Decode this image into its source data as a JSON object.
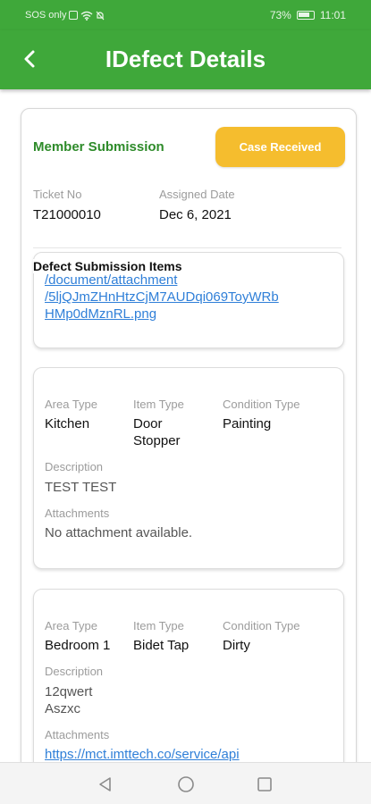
{
  "status_bar": {
    "left_text": "SOS only",
    "battery": "73%",
    "time": "11:01"
  },
  "app_bar": {
    "title": "IDefect Details"
  },
  "summary": {
    "heading": "Member Submission",
    "status_button": "Case Received",
    "ticket_no_label": "Ticket No",
    "ticket_no": "T21000010",
    "assigned_date_label": "Assigned Date",
    "assigned_date": "Dec 6, 2021",
    "section_title": "Defect Submission Items"
  },
  "items": [
    {
      "link_lines": [
        "/document/attachment",
        "/5ljQJmZHnHtzCjM7AUDqi069ToyWRb",
        "HMp0dMznRL.png"
      ]
    },
    {
      "area_type_label": "Area Type",
      "area_type": "Kitchen",
      "item_type_label": "Item Type",
      "item_type_lines": [
        "Door",
        "Stopper"
      ],
      "condition_type_label": "Condition Type",
      "condition_type": "Painting",
      "description_label": "Description",
      "description": "TEST TEST",
      "attachments_label": "Attachments",
      "attachments": "No attachment available."
    },
    {
      "area_type_label": "Area Type",
      "area_type": "Bedroom 1",
      "item_type_label": "Item Type",
      "item_type": "Bidet Tap",
      "condition_type_label": "Condition Type",
      "condition_type": "Dirty",
      "description_label": "Description",
      "description_lines": [
        "12qwert",
        "Aszxc"
      ],
      "attachments_label": "Attachments",
      "attachment_link": "https://mct.imttech.co/service/api"
    }
  ],
  "colors": {
    "primary_green": "#3fa83a",
    "heading_green": "#2e8b2a",
    "status_yellow": "#f5bd2e",
    "link_blue": "#2f7fd8"
  },
  "icons": [
    "back-arrow-icon",
    "nav-back-icon",
    "nav-home-icon",
    "nav-recents-icon",
    "wifi-icon",
    "battery-icon"
  ]
}
